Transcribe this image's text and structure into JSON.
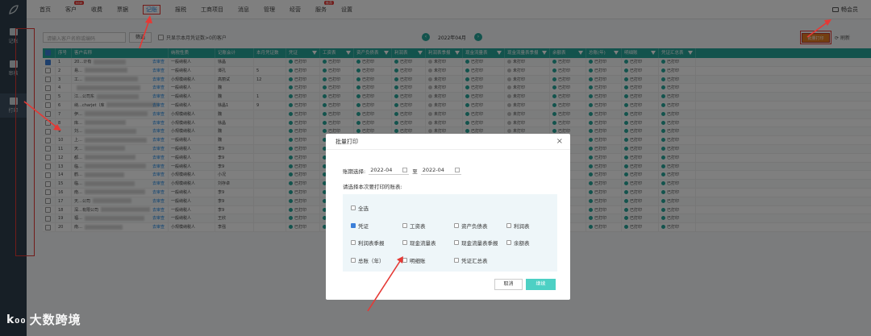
{
  "nav": {
    "items": [
      {
        "label": "首页",
        "badge": ""
      },
      {
        "label": "客户",
        "badge": "new"
      },
      {
        "label": "收费",
        "badge": ""
      },
      {
        "label": "票据",
        "badge": ""
      },
      {
        "label": "记账",
        "badge": ""
      },
      {
        "label": "报税",
        "badge": ""
      },
      {
        "label": "工商项目",
        "badge": ""
      },
      {
        "label": "消息",
        "badge": ""
      },
      {
        "label": "管理",
        "badge": ""
      },
      {
        "label": "经营",
        "badge": ""
      },
      {
        "label": "服务",
        "badge": "推荐"
      },
      {
        "label": "设置",
        "badge": ""
      }
    ],
    "active_index": 4,
    "member": "畅会员"
  },
  "sidebar": {
    "items": [
      {
        "label": "记账",
        "icon": "ledger-icon"
      },
      {
        "label": "审核",
        "icon": "audit-icon"
      },
      {
        "label": "打印",
        "icon": "print-icon"
      }
    ],
    "active_index": 2
  },
  "watermark": "大数跨境",
  "toolbar": {
    "search_placeholder": "请输入客户名称或编码",
    "filter_label": "筛选",
    "checkbox_label": "只显示本月凭证数>0的客户",
    "period": "2022年04月",
    "batch_print": "批量打印",
    "refresh": "刷新"
  },
  "table": {
    "columns": [
      "序号",
      "客户名称",
      "纳税性质",
      "记账会计",
      "本月凭证数",
      "凭证",
      "工资表",
      "资产负债表",
      "利润表",
      "利润表季报",
      "现金流量表",
      "现金流量表季报",
      "余额表",
      "总账(年)",
      "明细账",
      "凭证汇总表"
    ],
    "rows": [
      {
        "no": "1",
        "name": "20…计有",
        "type": "一般纳税人",
        "acct": "徐晶",
        "count": "",
        "status": [
          "已打印",
          "已打印",
          "已打印",
          "已打印",
          "未打印",
          "已打印",
          "未打印",
          "已打印",
          "已打印",
          "已打印",
          "已打印"
        ]
      },
      {
        "no": "2",
        "name": "易…",
        "type": "一般纳税人",
        "acct": "谭孔",
        "count": "5",
        "status": [
          "已打印",
          "已打印",
          "已打印",
          "已打印",
          "未打印",
          "已打印",
          "未打印",
          "已打印",
          "已打印",
          "已打印",
          "已打印"
        ]
      },
      {
        "no": "3",
        "name": "工…",
        "type": "小规模纳税人",
        "acct": "高丽试",
        "count": "12",
        "status": [
          "已打印",
          "已打印",
          "已打印",
          "已打印",
          "未打印",
          "已打印",
          "未打印",
          "已打印",
          "已打印",
          "已打印",
          "已打印"
        ]
      },
      {
        "no": "4",
        "name": "",
        "type": "一般纳税人",
        "acct": "魏",
        "count": "",
        "status": [
          "已打印",
          "已打印",
          "已打印",
          "已打印",
          "未打印",
          "已打印",
          "未打印",
          "已打印",
          "已打印",
          "已打印",
          "已打印"
        ]
      },
      {
        "no": "5",
        "name": "江…公司东",
        "type": "一般纳税人",
        "acct": "魏",
        "count": "1",
        "status": [
          "已打印",
          "已打印",
          "已打印",
          "已打印",
          "未打印",
          "已打印",
          "未打印",
          "已打印",
          "已打印",
          "已打印",
          "已打印"
        ]
      },
      {
        "no": "6",
        "name": "纳…charjet（库",
        "type": "一般纳税人",
        "acct": "徐晶1",
        "count": "9",
        "status": [
          "已打印",
          "已打印",
          "已打印",
          "已打印",
          "未打印",
          "已打印",
          "未打印",
          "已打印",
          "已打印",
          "已打印",
          "已打印"
        ]
      },
      {
        "no": "7",
        "name": "伊…",
        "type": "小规模纳税人",
        "acct": "魏",
        "count": "",
        "status": [
          "已打印",
          "已打印",
          "已打印",
          "已打印",
          "未打印",
          "已打印",
          "未打印",
          "已打印",
          "已打印",
          "已打印",
          "已打印"
        ]
      },
      {
        "no": "8",
        "name": "库…",
        "type": "小规模纳税人",
        "acct": "徐晶",
        "count": "",
        "status": [
          "已打印",
          "已打印",
          "已打印",
          "已打印",
          "未打印",
          "已打印",
          "未打印",
          "已打印",
          "已打印",
          "已打印",
          "已打印"
        ]
      },
      {
        "no": "9",
        "name": "刘…",
        "type": "小规模纳税人",
        "acct": "魏",
        "count": "",
        "status": [
          "已打印",
          "已打印",
          "已打印",
          "已打印",
          "未打印",
          "已打印",
          "未打印",
          "已打印",
          "已打印",
          "已打印",
          "已打印"
        ]
      },
      {
        "no": "10",
        "name": "上…",
        "type": "一般纳税人",
        "acct": "魏",
        "count": "",
        "status": [
          "已打印",
          "已打印",
          "已打印",
          "已打印",
          "未打印",
          "已打印",
          "未打印",
          "已打印",
          "已打印",
          "已打印",
          "已打印"
        ]
      },
      {
        "no": "11",
        "name": "天…",
        "type": "一般纳税人",
        "acct": "李9",
        "count": "",
        "status": [
          "已打印",
          "已打印",
          "已打印",
          "已打印",
          "未打印",
          "已打印",
          "未打印",
          "已打印",
          "已打印",
          "已打印",
          "已打印"
        ]
      },
      {
        "no": "12",
        "name": "都…",
        "type": "一般纳税人",
        "acct": "李9",
        "count": "",
        "status": [
          "已打印",
          "已打印",
          "已打印",
          "已打印",
          "未打印",
          "已打印",
          "未打印",
          "已打印",
          "已打印",
          "已打印",
          "已打印"
        ]
      },
      {
        "no": "13",
        "name": "临…",
        "type": "一般纳税人",
        "acct": "李9",
        "count": "",
        "status": [
          "已打印",
          "已打印",
          "已打印",
          "已打印",
          "未打印",
          "已打印",
          "未打印",
          "已打印",
          "已打印",
          "已打印",
          "已打印"
        ]
      },
      {
        "no": "14",
        "name": "鹤…",
        "type": "小规模纳税人",
        "acct": "小况",
        "count": "",
        "status": [
          "已打印",
          "已打印",
          "已打印",
          "已打印",
          "未打印",
          "已打印",
          "未打印",
          "已打印",
          "已打印",
          "已打印",
          "已打印"
        ]
      },
      {
        "no": "15",
        "name": "临…",
        "type": "小规模纳税人",
        "acct": "刘存卓",
        "count": "",
        "status": [
          "已打印",
          "已打印",
          "已打印",
          "已打印",
          "未打印",
          "已打印",
          "未打印",
          "已打印",
          "已打印",
          "已打印",
          "已打印"
        ]
      },
      {
        "no": "16",
        "name": "南…",
        "type": "一般纳税人",
        "acct": "李9",
        "count": "",
        "status": [
          "已打印",
          "已打印",
          "已打印",
          "已打印",
          "未打印",
          "已打印",
          "未打印",
          "已打印",
          "已打印",
          "已打印",
          "已打印"
        ]
      },
      {
        "no": "17",
        "name": "天…公司",
        "type": "一般纳税人",
        "acct": "李9",
        "count": "",
        "status": [
          "已打印",
          "已打印",
          "已打印",
          "已打印",
          "未打印",
          "已打印",
          "未打印",
          "已打印",
          "已打印",
          "已打印",
          "已打印"
        ]
      },
      {
        "no": "18",
        "name": "深…有限公司",
        "type": "一般纳税人",
        "acct": "李9",
        "count": "",
        "status": [
          "已打印",
          "已打印",
          "已打印",
          "已打印",
          "未打印",
          "已打印",
          "未打印",
          "已打印",
          "已打印",
          "已打印",
          "已打印"
        ]
      },
      {
        "no": "19",
        "name": "福…",
        "type": "一般纳税人",
        "acct": "王欣",
        "count": "",
        "status": [
          "已打印",
          "已打印",
          "已打印",
          "已打印",
          "未打印",
          "已打印",
          "未打印",
          "已打印",
          "已打印",
          "已打印",
          "已打印"
        ]
      },
      {
        "no": "20",
        "name": "南…",
        "type": "小规模纳税人",
        "acct": "李强",
        "count": "",
        "status": [
          "已打印",
          "已打印",
          "已打印",
          "已打印",
          "未打印",
          "已打印",
          "未打印",
          "已打印",
          "已打印",
          "已打印",
          "已打印"
        ]
      }
    ],
    "link_label": "去审查"
  },
  "modal": {
    "title": "批量打印",
    "period_label": "账期选择:",
    "start": "2022-04",
    "to": "至",
    "end": "2022-04",
    "sub": "请选择本次要打印的账表:",
    "options": [
      {
        "label": "全选",
        "checked": false
      },
      {
        "label": "凭证",
        "checked": true
      },
      {
        "label": "工资表",
        "checked": false
      },
      {
        "label": "资产负债表",
        "checked": false
      },
      {
        "label": "利润表",
        "checked": false
      },
      {
        "label": "利润表季报",
        "checked": false
      },
      {
        "label": "现金流量表",
        "checked": false
      },
      {
        "label": "现金流量表季报",
        "checked": false
      },
      {
        "label": "余额表",
        "checked": false
      },
      {
        "label": "总账（年）",
        "checked": false
      },
      {
        "label": "明细账",
        "checked": false
      },
      {
        "label": "凭证汇总表",
        "checked": false
      }
    ],
    "cancel": "取消",
    "ok": "继续"
  }
}
